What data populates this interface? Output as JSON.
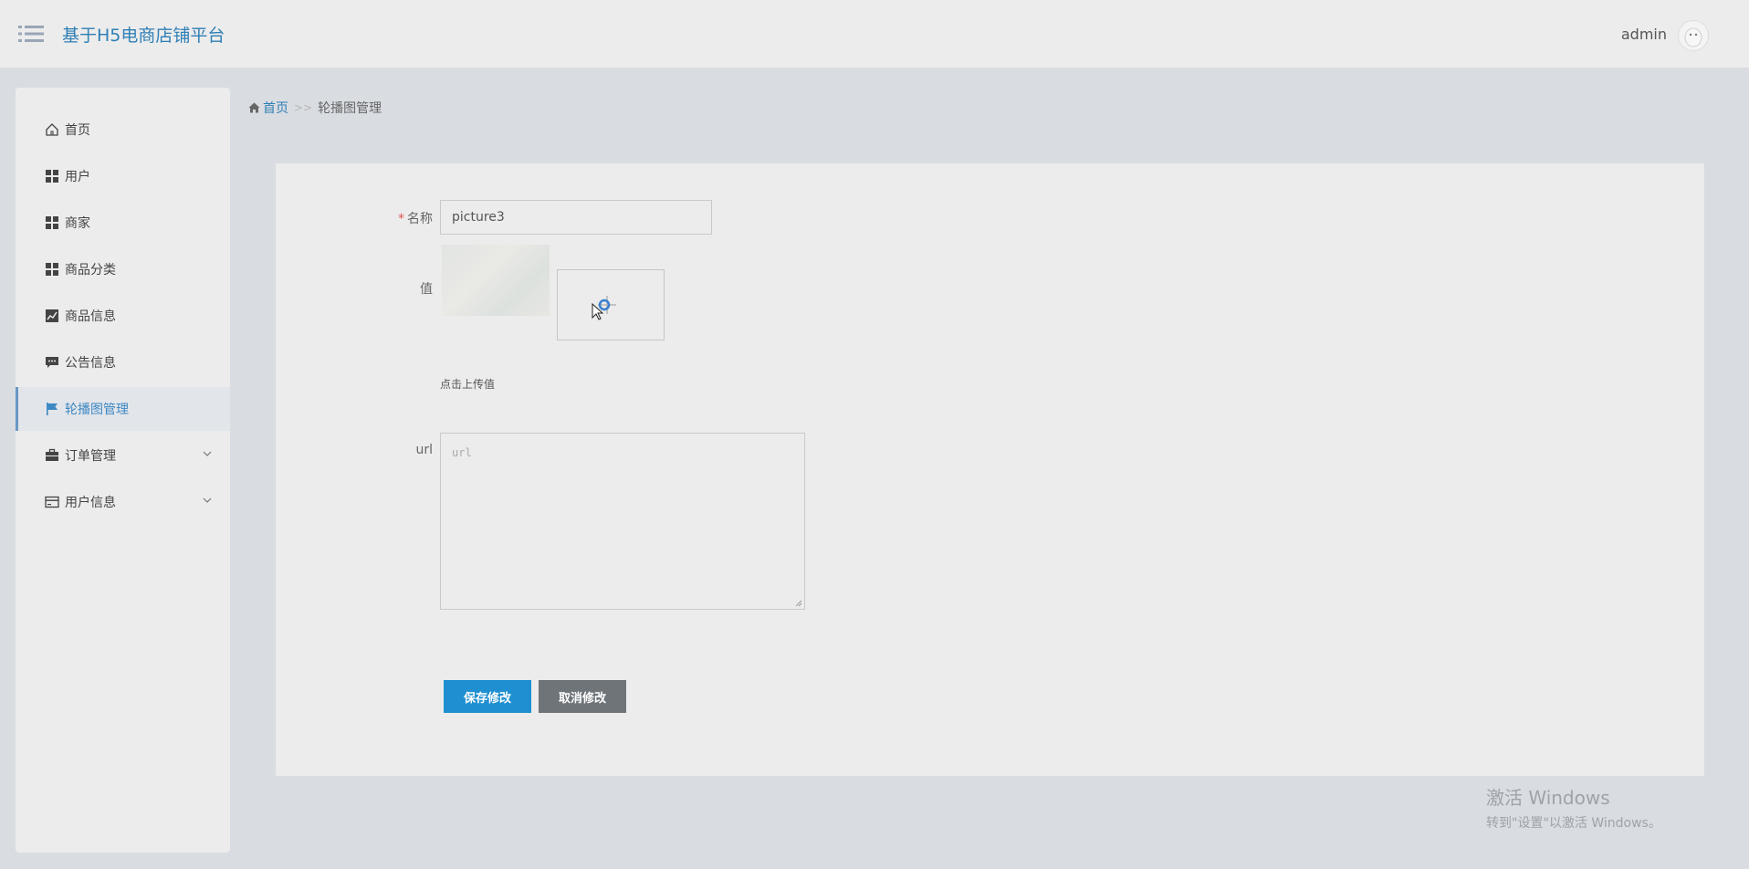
{
  "header": {
    "title": "基于H5电商店铺平台",
    "user": "admin"
  },
  "sidebar": {
    "items": [
      {
        "label": "首页",
        "icon": "home-icon"
      },
      {
        "label": "用户",
        "icon": "grid-icon"
      },
      {
        "label": "商家",
        "icon": "grid-icon"
      },
      {
        "label": "商品分类",
        "icon": "grid-icon"
      },
      {
        "label": "商品信息",
        "icon": "chart-icon"
      },
      {
        "label": "公告信息",
        "icon": "comment-icon"
      },
      {
        "label": "轮播图管理",
        "icon": "flag-icon",
        "active": true
      },
      {
        "label": "订单管理",
        "icon": "briefcase-icon",
        "expandable": true
      },
      {
        "label": "用户信息",
        "icon": "card-icon",
        "expandable": true
      }
    ]
  },
  "breadcrumb": {
    "home": "首页",
    "separator": ">>",
    "current": "轮播图管理"
  },
  "form": {
    "name_label": "名称",
    "name_required_mark": "*",
    "name_value": "picture3",
    "value_label": "值",
    "upload_hint": "点击上传值",
    "url_label": "url",
    "url_placeholder": "url",
    "save_label": "保存修改",
    "cancel_label": "取消修改"
  },
  "watermark": {
    "title": "激活 Windows",
    "subtitle": "转到\"设置\"以激活 Windows。"
  },
  "colors": {
    "accent": "#2f7fb6",
    "save_button": "#1f8fd1",
    "cancel_button": "#6f7479",
    "active_nav_bar": "#6a98c4"
  }
}
